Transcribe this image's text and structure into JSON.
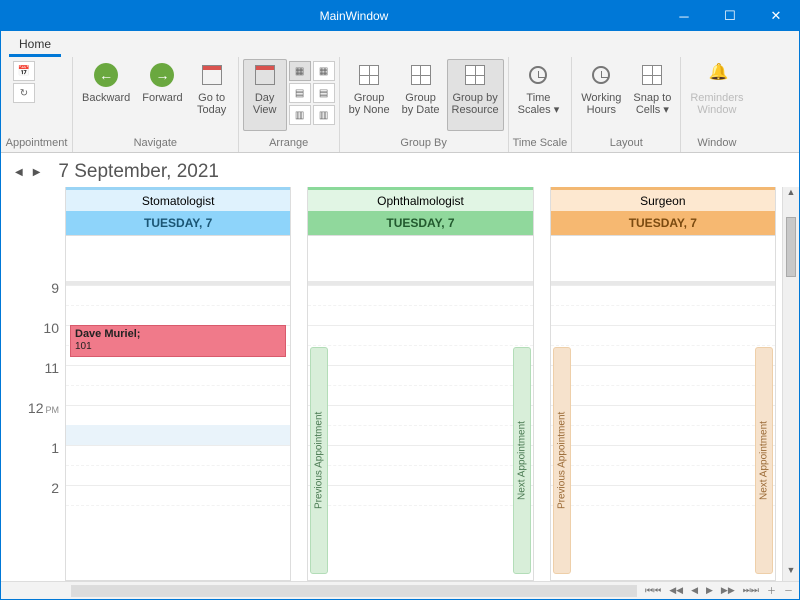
{
  "window": {
    "title": "MainWindow"
  },
  "tabs": {
    "home": "Home"
  },
  "ribbon": {
    "appointment": {
      "group_label": "Appointment"
    },
    "navigate": {
      "group_label": "Navigate",
      "backward": "Backward",
      "forward": "Forward",
      "go_to_today_1": "Go to",
      "go_to_today_2": "Today"
    },
    "arrange": {
      "group_label": "Arrange",
      "day_view_1": "Day",
      "day_view_2": "View"
    },
    "groupby": {
      "group_label": "Group By",
      "none_1": "Group",
      "none_2": "by None",
      "date_1": "Group",
      "date_2": "by Date",
      "res_1": "Group by",
      "res_2": "Resource"
    },
    "timescale": {
      "group_label": "Time Scale",
      "time_1": "Time",
      "time_2": "Scales ▾"
    },
    "layout": {
      "group_label": "Layout",
      "hours_1": "Working",
      "hours_2": "Hours",
      "snap_1": "Snap to",
      "snap_2": "Cells ▾"
    },
    "window_grp": {
      "group_label": "Window",
      "reminders_1": "Reminders",
      "reminders_2": "Window"
    }
  },
  "calendar": {
    "title": "7 September, 2021",
    "hours": [
      "9",
      "10",
      "11",
      "12",
      "1",
      "2"
    ],
    "noon_suffix": "PM",
    "resources": [
      {
        "name": "Stomatologist",
        "day": "TUESDAY, 7",
        "class": "res-stomo"
      },
      {
        "name": "Ophthalmologist",
        "day": "TUESDAY, 7",
        "class": "res-ophth"
      },
      {
        "name": "Surgeon",
        "day": "TUESDAY, 7",
        "class": "res-surg"
      }
    ],
    "appointment": {
      "subject": "Dave Muriel;",
      "location": "101"
    },
    "prev_label": "Previous Appointment",
    "next_label": "Next Appointment"
  }
}
